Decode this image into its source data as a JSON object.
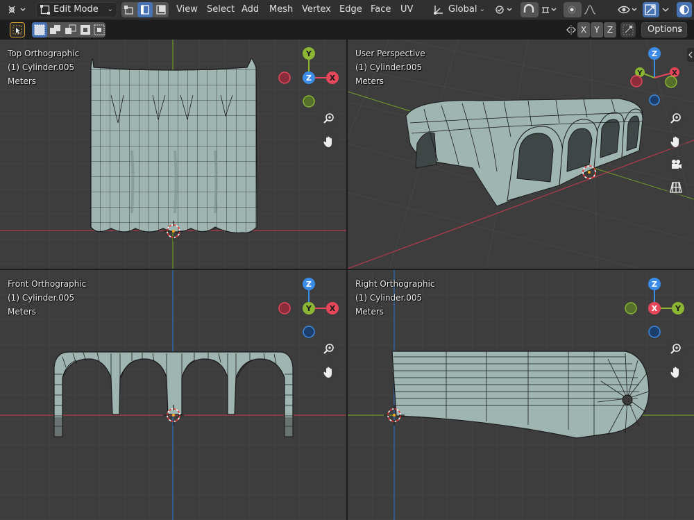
{
  "header": {
    "mode": "Edit Mode",
    "menus": [
      "View",
      "Select",
      "Add",
      "Mesh",
      "Vertex",
      "Edge",
      "Face",
      "UV"
    ],
    "orientation": "Global"
  },
  "toolbar2": {
    "axis_buttons": [
      "X",
      "Y",
      "Z"
    ],
    "options_label": "Options"
  },
  "viewports": {
    "top": {
      "title": "Top Orthographic",
      "object": "(1) Cylinder.005",
      "units": "Meters",
      "gizmo": {
        "center": "Z",
        "up": "Y",
        "right": "X"
      }
    },
    "persp": {
      "title": "User Perspective",
      "object": "(1) Cylinder.005",
      "units": "Meters"
    },
    "front": {
      "title": "Front Orthographic",
      "object": "(1) Cylinder.005",
      "units": "Meters",
      "gizmo": {
        "center": "Y",
        "up": "Z",
        "right": "X"
      }
    },
    "right": {
      "title": "Right Orthographic",
      "object": "(1) Cylinder.005",
      "units": "Meters",
      "gizmo": {
        "center": "X",
        "up": "Z",
        "right": "Y"
      }
    }
  },
  "colors": {
    "axis_x": "#e6475a",
    "axis_y": "#8cb734",
    "axis_z": "#3b8ce6",
    "mesh": "#9fb5b1",
    "wire": "#1a1a1a",
    "viewport_bg": "#3d3d3d",
    "selected": "#4772b3"
  },
  "icons": [
    "tool-settings-icon",
    "vertex-select-icon",
    "edge-select-icon",
    "face-select-icon",
    "transform-orientation-icon",
    "pivot-icon",
    "snap-icon",
    "proportional-icon",
    "overlay-icon",
    "xray-icon",
    "viewport-shading-icon",
    "zoom-icon",
    "hand-pan-icon",
    "camera-icon",
    "grid-icon",
    "cursor-select-icon"
  ]
}
